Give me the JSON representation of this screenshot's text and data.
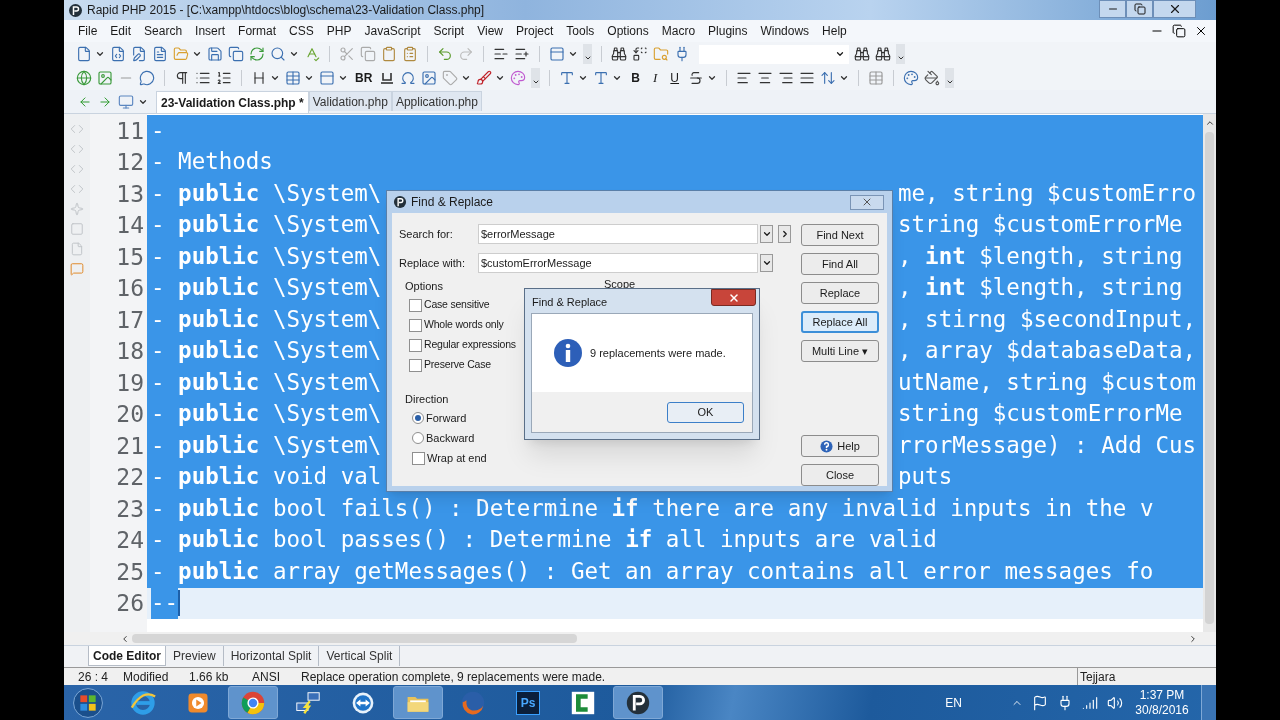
{
  "window": {
    "title": "Rapid PHP 2015 - [C:\\xampp\\htdocs\\blog\\schema\\23-Validation Class.php]"
  },
  "menu": [
    "File",
    "Edit",
    "Search",
    "Insert",
    "Format",
    "CSS",
    "PHP",
    "JavaScript",
    "Script",
    "View",
    "Project",
    "Tools",
    "Options",
    "Macro",
    "Plugins",
    "Windows",
    "Help"
  ],
  "format_buttons": [
    "BR",
    "B",
    "I",
    "U"
  ],
  "file_tabs": [
    {
      "label": "23-Validation Class.php *",
      "selected": true
    },
    {
      "label": "Validation.php",
      "selected": false
    },
    {
      "label": "Application.php",
      "selected": false
    }
  ],
  "editor": {
    "lines": [
      {
        "number": "11",
        "left": "-",
        "current": false
      },
      {
        "number": "12",
        "left": "- Methods",
        "current": false
      },
      {
        "number": "13",
        "left": "- **public** \\System\\",
        "right": "me, string $customErro",
        "current": false
      },
      {
        "number": "14",
        "left": "- **public** \\System\\",
        "right": "string $customErrorMe",
        "current": false
      },
      {
        "number": "15",
        "left": "- **public** \\System\\",
        "right": ", **int** $length, string",
        "current": false
      },
      {
        "number": "16",
        "left": "- **public** \\System\\",
        "right": ", **int** $length, string",
        "current": false
      },
      {
        "number": "17",
        "left": "- **public** \\System\\",
        "right": ", stirng $secondInput,",
        "current": false
      },
      {
        "number": "18",
        "left": "- **public** \\System\\",
        "right": ", array $databaseData,",
        "current": false
      },
      {
        "number": "19",
        "left": "- **public** \\System\\",
        "right": "utName, string $custom",
        "current": false
      },
      {
        "number": "20",
        "left": "- **public** \\System\\",
        "right": "string $customErrorMe",
        "current": false
      },
      {
        "number": "21",
        "left": "- **public** \\System\\",
        "right": "rrorMessage) : Add Cus",
        "current": false
      },
      {
        "number": "22",
        "left": "- **public** void val",
        "right": "puts",
        "current": false
      },
      {
        "number": "23",
        "left": "- **public** bool fails() : Determine **if** there are any invalid inputs in the v",
        "current": false
      },
      {
        "number": "24",
        "left": "- **public** bool passes() : Determine **if** all inputs are valid",
        "current": false
      },
      {
        "number": "25",
        "left": "- **public** array getMessages() : Get an array contains all error messages fo",
        "current": false
      },
      {
        "number": "26",
        "left": "--",
        "current": true
      }
    ]
  },
  "find_dialog": {
    "title": "Find & Replace",
    "search_label": "Search for:",
    "search_value": "$errorMessage",
    "replace_label": "Replace with:",
    "replace_value": "$customErrorMessage",
    "options_label": "Options",
    "scope_label": "Scope",
    "options": [
      {
        "label": "Case sensitive",
        "checked": false
      },
      {
        "label": "Whole words only",
        "checked": false
      },
      {
        "label": "Regular expressions",
        "checked": false
      },
      {
        "label": "Preserve Case",
        "checked": false
      }
    ],
    "direction_label": "Direction",
    "directions": [
      {
        "label": "Forward",
        "selected": true
      },
      {
        "label": "Backward",
        "selected": false
      }
    ],
    "wrap": {
      "label": "Wrap at end",
      "checked": false
    },
    "buttons": [
      {
        "label": "Find Next",
        "default": false
      },
      {
        "label": "Find All",
        "default": false
      },
      {
        "label": "Replace",
        "default": false
      },
      {
        "label": "Replace All",
        "default": true
      },
      {
        "label": "Multi Line ▾",
        "default": false
      }
    ],
    "bottom_buttons": [
      {
        "kind": "help",
        "label": "Help"
      },
      {
        "kind": "plain",
        "label": "Close"
      }
    ]
  },
  "message_box": {
    "title": "Find & Replace",
    "message": "9 replacements were made.",
    "button": "OK"
  },
  "view_tabs": [
    {
      "label": "Code Editor",
      "selected": true
    },
    {
      "label": "Preview",
      "selected": false
    },
    {
      "label": "Horizontal Split",
      "selected": false
    },
    {
      "label": "Vertical Split",
      "selected": false
    }
  ],
  "status_bar": {
    "items": [
      "26 : 4",
      "Modified",
      "1.66 kb",
      "ANSI",
      "Replace operation complete, 9 replacements were made."
    ],
    "right": "Tejjara"
  },
  "taskbar": {
    "apps": [
      {
        "kind": "ie",
        "running": false
      },
      {
        "kind": "media",
        "running": false
      },
      {
        "kind": "chrome",
        "running": true
      },
      {
        "kind": "network",
        "running": false
      },
      {
        "kind": "teamviewer",
        "running": false
      },
      {
        "kind": "explorer",
        "running": true
      },
      {
        "kind": "firefox",
        "running": false
      },
      {
        "kind": "photoshop",
        "running": false,
        "label": "Ps"
      },
      {
        "kind": "camtasia",
        "running": false
      },
      {
        "kind": "rapidphp",
        "running": true
      }
    ],
    "language": "EN",
    "time": "1:37 PM",
    "date": "30/8/2016"
  }
}
